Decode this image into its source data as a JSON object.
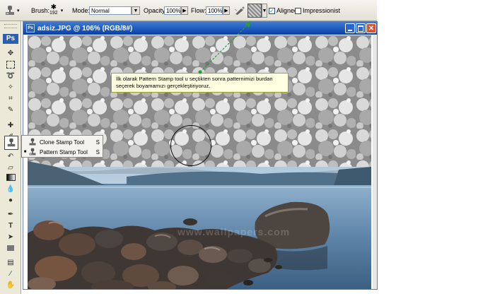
{
  "options_bar": {
    "brush_label": "Brush:",
    "brush_size": "192",
    "mode_label": "Mode:",
    "mode_value": "Normal",
    "opacity_label": "Opacity:",
    "opacity_value": "100%",
    "flow_label": "Flow:",
    "flow_value": "100%",
    "aligned_label": "Aligned",
    "aligned_checked": true,
    "impressionist_label": "Impressionist",
    "impressionist_checked": false
  },
  "toolbar": {
    "logo": "Ps"
  },
  "document": {
    "title": "adsiz.JPG @ 106% (RGB/8#)",
    "watermark": "www.wallpapers.com"
  },
  "tool_flyout": {
    "items": [
      {
        "label": "Clone Stamp Tool",
        "shortcut": "S",
        "selected": false
      },
      {
        "label": "Pattern Stamp Tool",
        "shortcut": "S",
        "selected": true
      }
    ]
  },
  "annotation": {
    "text": "İlk olarak Pattern Stamp tool u seçtikten sonra patternimizi burdan seçerek boyamamızı gerçekleştiriyoruz."
  },
  "colors": {
    "accent_arrow": "#2e9a3e",
    "titlebar": "#0a3fa6",
    "tooltip_bg": "#ffffe1"
  }
}
